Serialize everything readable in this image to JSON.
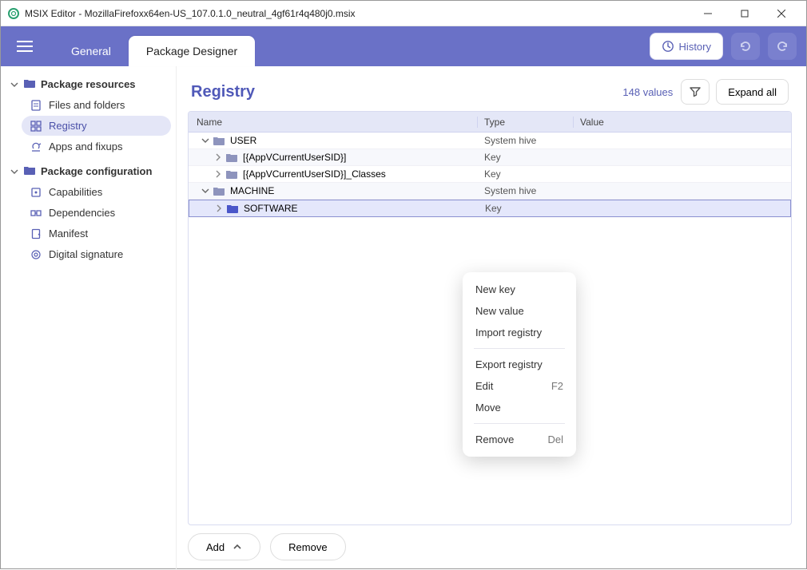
{
  "window": {
    "title": "MSIX Editor - MozillaFirefoxx64en-US_107.0.1.0_neutral_4gf61r4q480j0.msix"
  },
  "topbar": {
    "tabs": {
      "general": "General",
      "designer": "Package Designer"
    },
    "history": "History"
  },
  "sidebar": {
    "resources_label": "Package resources",
    "files": "Files and folders",
    "registry": "Registry",
    "apps": "Apps and fixups",
    "config_label": "Package configuration",
    "capabilities": "Capabilities",
    "dependencies": "Dependencies",
    "manifest": "Manifest",
    "signature": "Digital signature"
  },
  "main": {
    "title": "Registry",
    "value_count": "148 values",
    "expand_all": "Expand all",
    "columns": {
      "name": "Name",
      "type": "Type",
      "value": "Value"
    },
    "rows": [
      {
        "indent": 0,
        "chev": "down",
        "color": "grey",
        "name": "USER",
        "type": "System hive"
      },
      {
        "indent": 1,
        "chev": "right",
        "color": "grey",
        "name": "[{AppVCurrentUserSID}]",
        "type": "Key"
      },
      {
        "indent": 1,
        "chev": "right",
        "color": "grey",
        "name": "[{AppVCurrentUserSID}]_Classes",
        "type": "Key"
      },
      {
        "indent": 0,
        "chev": "down",
        "color": "grey",
        "name": "MACHINE",
        "type": "System hive"
      },
      {
        "indent": 1,
        "chev": "right",
        "color": "blue",
        "name": "SOFTWARE",
        "type": "Key",
        "selected": true
      }
    ]
  },
  "footer": {
    "add": "Add",
    "remove": "Remove"
  },
  "context_menu": {
    "new_key": "New key",
    "new_value": "New value",
    "import": "Import registry",
    "export": "Export registry",
    "edit": "Edit",
    "edit_key": "F2",
    "move": "Move",
    "remove": "Remove",
    "remove_key": "Del"
  }
}
